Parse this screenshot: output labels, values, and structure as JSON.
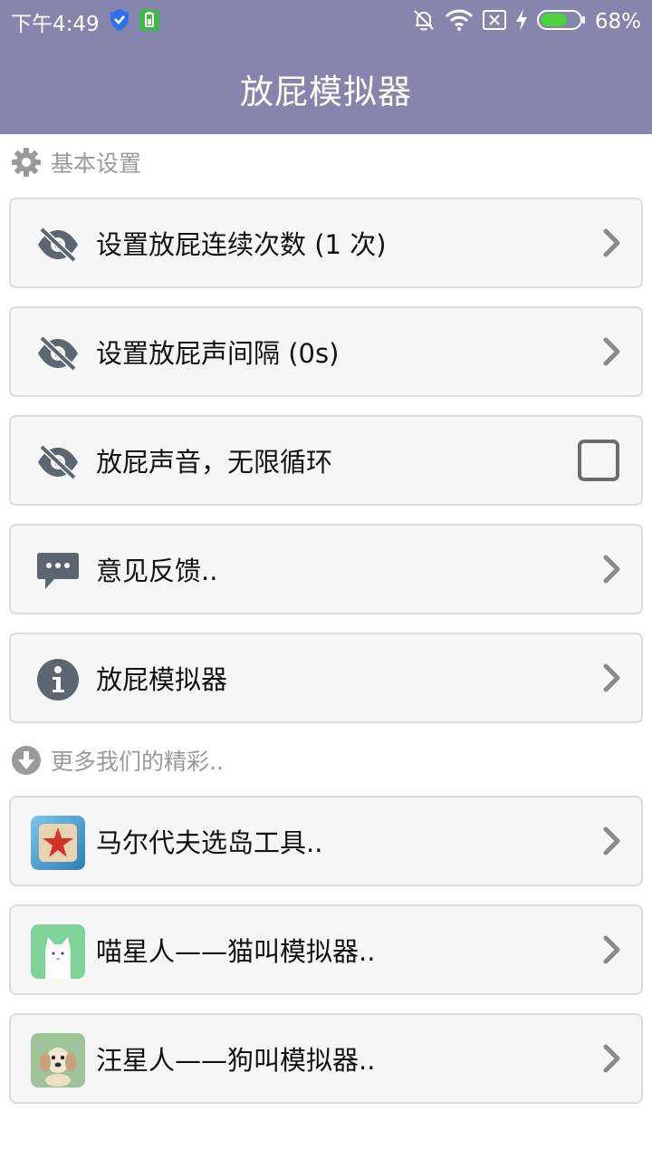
{
  "status_bar": {
    "time": "下午4:49",
    "battery_percent": "68%",
    "battery_level": 0.68,
    "icons": [
      "shield-icon",
      "battery-saver-icon",
      "bell-off-icon",
      "wifi-icon",
      "no-sim-icon",
      "charging-icon",
      "battery-icon"
    ]
  },
  "app_bar": {
    "title": "放屁模拟器"
  },
  "sections": {
    "basic": {
      "title": "基本设置",
      "icon": "gear-icon"
    },
    "more": {
      "title": "更多我们的精彩..",
      "icon": "download-circle-icon"
    }
  },
  "settings": [
    {
      "label": "设置放屁连续次数 (1 次)",
      "icon": "eye-off-icon",
      "action": "chevron"
    },
    {
      "label": "设置放屁声间隔 (0s)",
      "icon": "eye-off-icon",
      "action": "chevron"
    },
    {
      "label": "放屁声音，无限循环",
      "icon": "eye-off-icon",
      "action": "checkbox",
      "checked": false
    },
    {
      "label": "意见反馈..",
      "icon": "chat-bubble-icon",
      "action": "chevron"
    },
    {
      "label": "放屁模拟器",
      "icon": "info-icon",
      "action": "chevron"
    }
  ],
  "apps": [
    {
      "label": "马尔代夫选岛工具..",
      "icon": "starfish-app-icon"
    },
    {
      "label": "喵星人——猫叫模拟器..",
      "icon": "cat-app-icon"
    },
    {
      "label": "汪星人——狗叫模拟器..",
      "icon": "puppy-app-icon"
    }
  ],
  "colors": {
    "primary": "#8685ad",
    "card_bg": "#f6f6f6",
    "card_border": "#dcdcdc",
    "icon_gray": "#5c6670",
    "section_text": "#9a9a9a"
  }
}
